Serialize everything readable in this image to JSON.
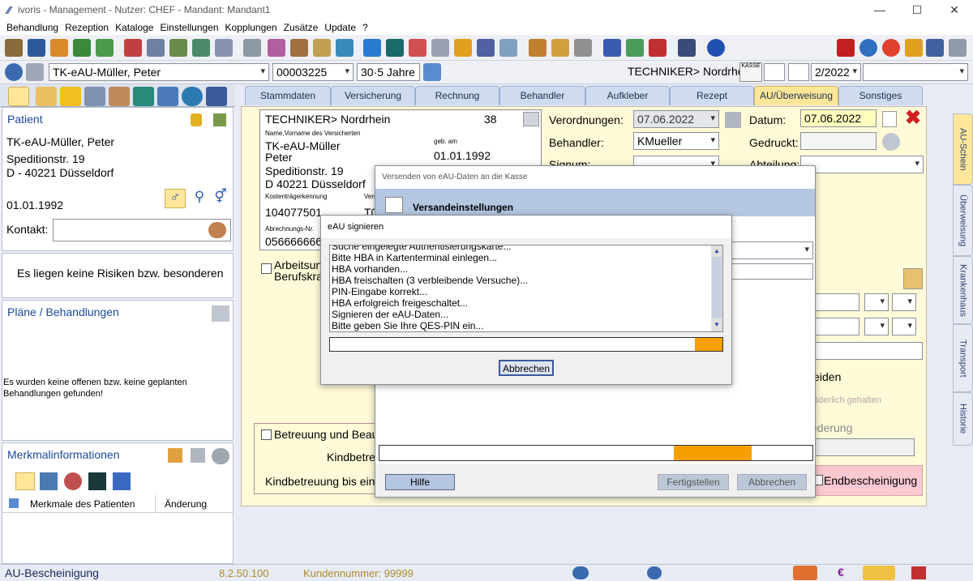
{
  "window": {
    "title": "ivoris - Management - Nutzer: CHEF - Mandant: Mandant1"
  },
  "menu": [
    "Behandlung",
    "Rezeption",
    "Kataloge",
    "Einstellungen",
    "Kopplungen",
    "Zusätze",
    "Update",
    "?"
  ],
  "toolbar2": {
    "patient_name": "TK-eAU-Müller, Peter",
    "patient_id": "00003225",
    "age": "30·5 Jahre",
    "kasse_label": "KASSE",
    "insurer": "TECHNIKER> Nordrhein",
    "quarter": "2/2022"
  },
  "left": {
    "patient": {
      "heading": "Patient",
      "name": "TK-eAU-Müller, Peter",
      "street": "Speditionstr. 19",
      "city": "D - 40221 Düsseldorf",
      "dob": "01.01.1992",
      "contact_label": "Kontakt:"
    },
    "risks_text": "Es liegen keine Risiken bzw. besonderen",
    "plans": {
      "heading": "Pläne / Behandlungen",
      "text": "Es wurden keine offenen bzw. keine geplanten Behandlungen gefunden!"
    },
    "merkmal": {
      "heading": "Merkmalinformationen",
      "col1": "Merkmale des Patienten",
      "col2": "Änderung"
    }
  },
  "tabs": [
    "Stammdaten",
    "Versicherung",
    "Rechnung",
    "Behandler",
    "Aufkleber",
    "Rezept",
    "AU/Überweisung",
    "Sonstiges"
  ],
  "active_tab": "AU/Überweisung",
  "vtabs": [
    "AU-Schein",
    "Überweisung",
    "Krankenhaus",
    "Transport",
    "Historie"
  ],
  "card": {
    "insurer": "TECHNIKER> Nordrhein",
    "number": "38",
    "name_label": "Name,Vorname des Versicherten",
    "dob_label": "geb. am",
    "last": "TK-eAU-Müller",
    "first": "Peter",
    "dob": "01.01.1992",
    "street": "Speditionstr. 19",
    "city": "D 40221 Düsseldorf",
    "kt_label": "Kostenträgerkennung",
    "vers_label": "Vers",
    "kt": "104077501",
    "vers": "T0",
    "abr_label": "Abrechnungs-Nr.",
    "abr": "0566666666"
  },
  "form": {
    "verordnungen_label": "Verordnungen:",
    "verordnungen": "07.06.2022",
    "datum_label": "Datum:",
    "datum": "07.06.2022",
    "behandler_label": "Behandler:",
    "behandler": "KMueller",
    "gedruckt_label": "Gedruckt:",
    "signum_label": "Signum:",
    "abteilung_label": "Abteilung:",
    "arbeitsunfall": "Arbeitsun",
    "berufskrank": "Berufskra",
    "leiden": "leiden",
    "foerderlich": "föderlich gehalten",
    "ederung": "ederung",
    "betreuung": "Betreuung und Beauf",
    "kindbetre": "Kindbetre",
    "kindbetreuung_bis": "Kindbetreuung bis eins",
    "endbescheinigung": "Endbescheinigung"
  },
  "dlg_versand": {
    "title": "Versenden von eAU-Daten an die Kasse",
    "subtitle": "Versandeinstellungen",
    "hilfe": "Hilfe",
    "fertig": "Fertigstellen",
    "abbrechen": "Abbrechen",
    "progress": 0.18
  },
  "dlg_sign": {
    "title": "eAU signieren",
    "log": [
      "Suche eingelegte Authentisierungskarte...",
      "Bitte HBA in Kartenterminal einlegen...",
      "HBA vorhanden...",
      "HBA freischalten (3 verbleibende Versuche)...",
      "PIN-Eingabe korrekt...",
      "HBA erfolgreich freigeschaltet...",
      "Signieren der eAU-Daten...",
      "Bitte geben Sie Ihre QES-PIN ein..."
    ],
    "abbrechen": "Abbrechen",
    "progress": 0.07
  },
  "status": {
    "left": "AU-Bescheinigung",
    "version": "8.2.50.100",
    "kunde": "Kundennummer: 99999"
  },
  "colors": {
    "accent_orange": "#f5a000",
    "tab_active": "#ffe79a",
    "blue_heading": "#1a4a9a",
    "close_red": "#d02020"
  }
}
